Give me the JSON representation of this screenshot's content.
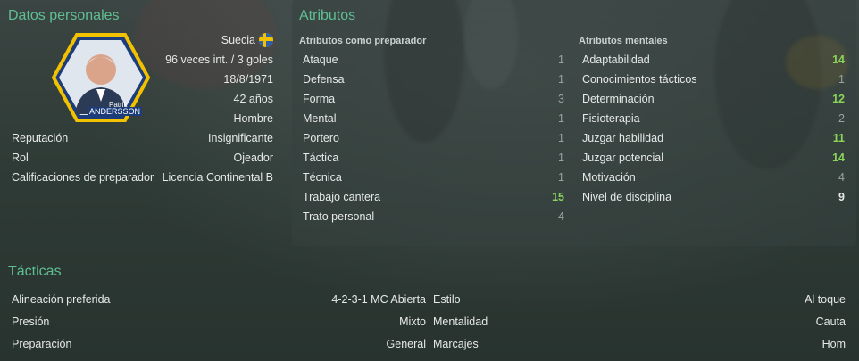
{
  "personal": {
    "title": "Datos personales",
    "nation": "Suecia",
    "caps": "96 veces int. / 3 goles",
    "dob": "18/8/1971",
    "age": "42 años",
    "gender": "Hombre",
    "badge_first": "Patrik",
    "badge_last": "ANDERSSON",
    "rows": [
      {
        "label": "Reputación",
        "value": "Insignificante"
      },
      {
        "label": "Rol",
        "value": "Ojeador"
      },
      {
        "label": "Calificaciones de preparador",
        "value": "Licencia Continental B"
      }
    ]
  },
  "attributes": {
    "title": "Atributos",
    "coaching_header": "Atributos como preparador",
    "mental_header": "Atributos mentales",
    "coaching": [
      {
        "label": "Ataque",
        "value": "1"
      },
      {
        "label": "Defensa",
        "value": "1"
      },
      {
        "label": "Forma",
        "value": "3"
      },
      {
        "label": "Mental",
        "value": "1"
      },
      {
        "label": "Portero",
        "value": "1"
      },
      {
        "label": "Táctica",
        "value": "1"
      },
      {
        "label": "Técnica",
        "value": "1"
      },
      {
        "label": "Trabajo cantera",
        "value": "15"
      },
      {
        "label": "Trato personal",
        "value": "4"
      }
    ],
    "mental": [
      {
        "label": "Adaptabilidad",
        "value": "14"
      },
      {
        "label": "Conocimientos tácticos",
        "value": "1"
      },
      {
        "label": "Determinación",
        "value": "12"
      },
      {
        "label": "Fisioterapia",
        "value": "2"
      },
      {
        "label": "Juzgar habilidad",
        "value": "11"
      },
      {
        "label": "Juzgar potencial",
        "value": "14"
      },
      {
        "label": "Motivación",
        "value": "4"
      },
      {
        "label": "Nivel de disciplina",
        "value": "9"
      }
    ]
  },
  "tactics": {
    "title": "Tácticas",
    "left": [
      {
        "label": "Alineación preferida",
        "value": "4-2-3-1 MC Abierta"
      },
      {
        "label": "Presión",
        "value": "Mixto"
      },
      {
        "label": "Preparación",
        "value": "General"
      }
    ],
    "right": [
      {
        "label": "Estilo",
        "value": "Al toque"
      },
      {
        "label": "Mentalidad",
        "value": "Cauta"
      },
      {
        "label": "Marcajes",
        "value": "Hom"
      }
    ]
  },
  "colors": {
    "accent": "#5fbf93",
    "high": "#8ad45a",
    "sweden_yellow": "#f2c200",
    "sweden_blue": "#2f5fa8"
  }
}
